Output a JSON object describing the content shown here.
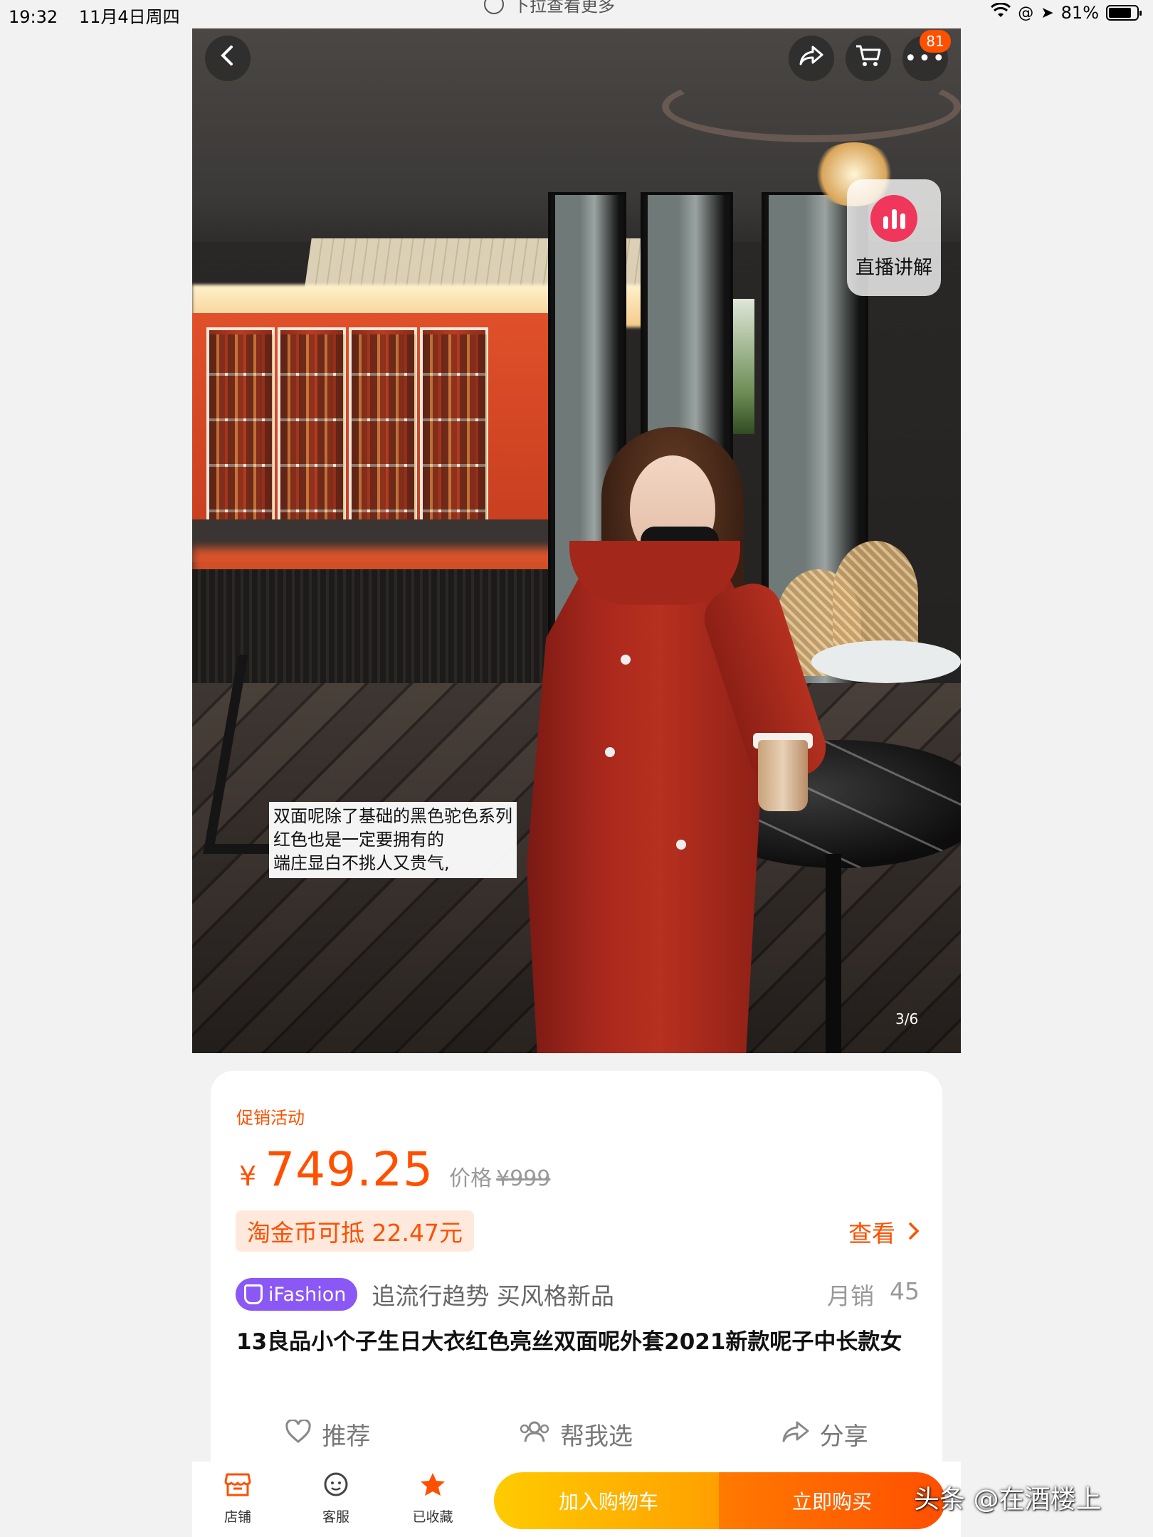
{
  "status_bar": {
    "time": "19:32",
    "date": "11月4日周四",
    "pull_hint": "下拉查看更多",
    "battery": "81%"
  },
  "hero": {
    "page_indicator": "3/6",
    "cart_badge": "81",
    "live_label": "直播讲解",
    "caption_lines": [
      "双面呢除了基础的黑色驼色系列",
      "红色也是一定要拥有的",
      "端庄显白不挑人又贵气,"
    ]
  },
  "product": {
    "promo_label": "促销活动",
    "currency": "¥",
    "price": "749.25",
    "original_label": "价格",
    "original_price": "¥999",
    "coin_text": "淘金币可抵 22.47元",
    "view_label": "查看",
    "brand": "iFashion",
    "slogan": "追流行趋势 买风格新品",
    "sales_label": "月销",
    "sales_value": "45",
    "title": "13良品小个子生日大衣红色亮丝双面呢外套2021新款呢子中长款女"
  },
  "actions": {
    "recommend": "推荐",
    "help_choose": "帮我选",
    "share": "分享"
  },
  "bottom_bar": {
    "shop": "店铺",
    "service": "客服",
    "favorited": "已收藏",
    "add_cart": "加入购物车",
    "buy_now": "立即购买"
  },
  "watermark": "头条 @在酒楼上",
  "colors": {
    "accent": "#ff5000",
    "ifashion": "#8b57f5",
    "cart_button": "#ffb000",
    "buy_button": "#ff5a00"
  }
}
